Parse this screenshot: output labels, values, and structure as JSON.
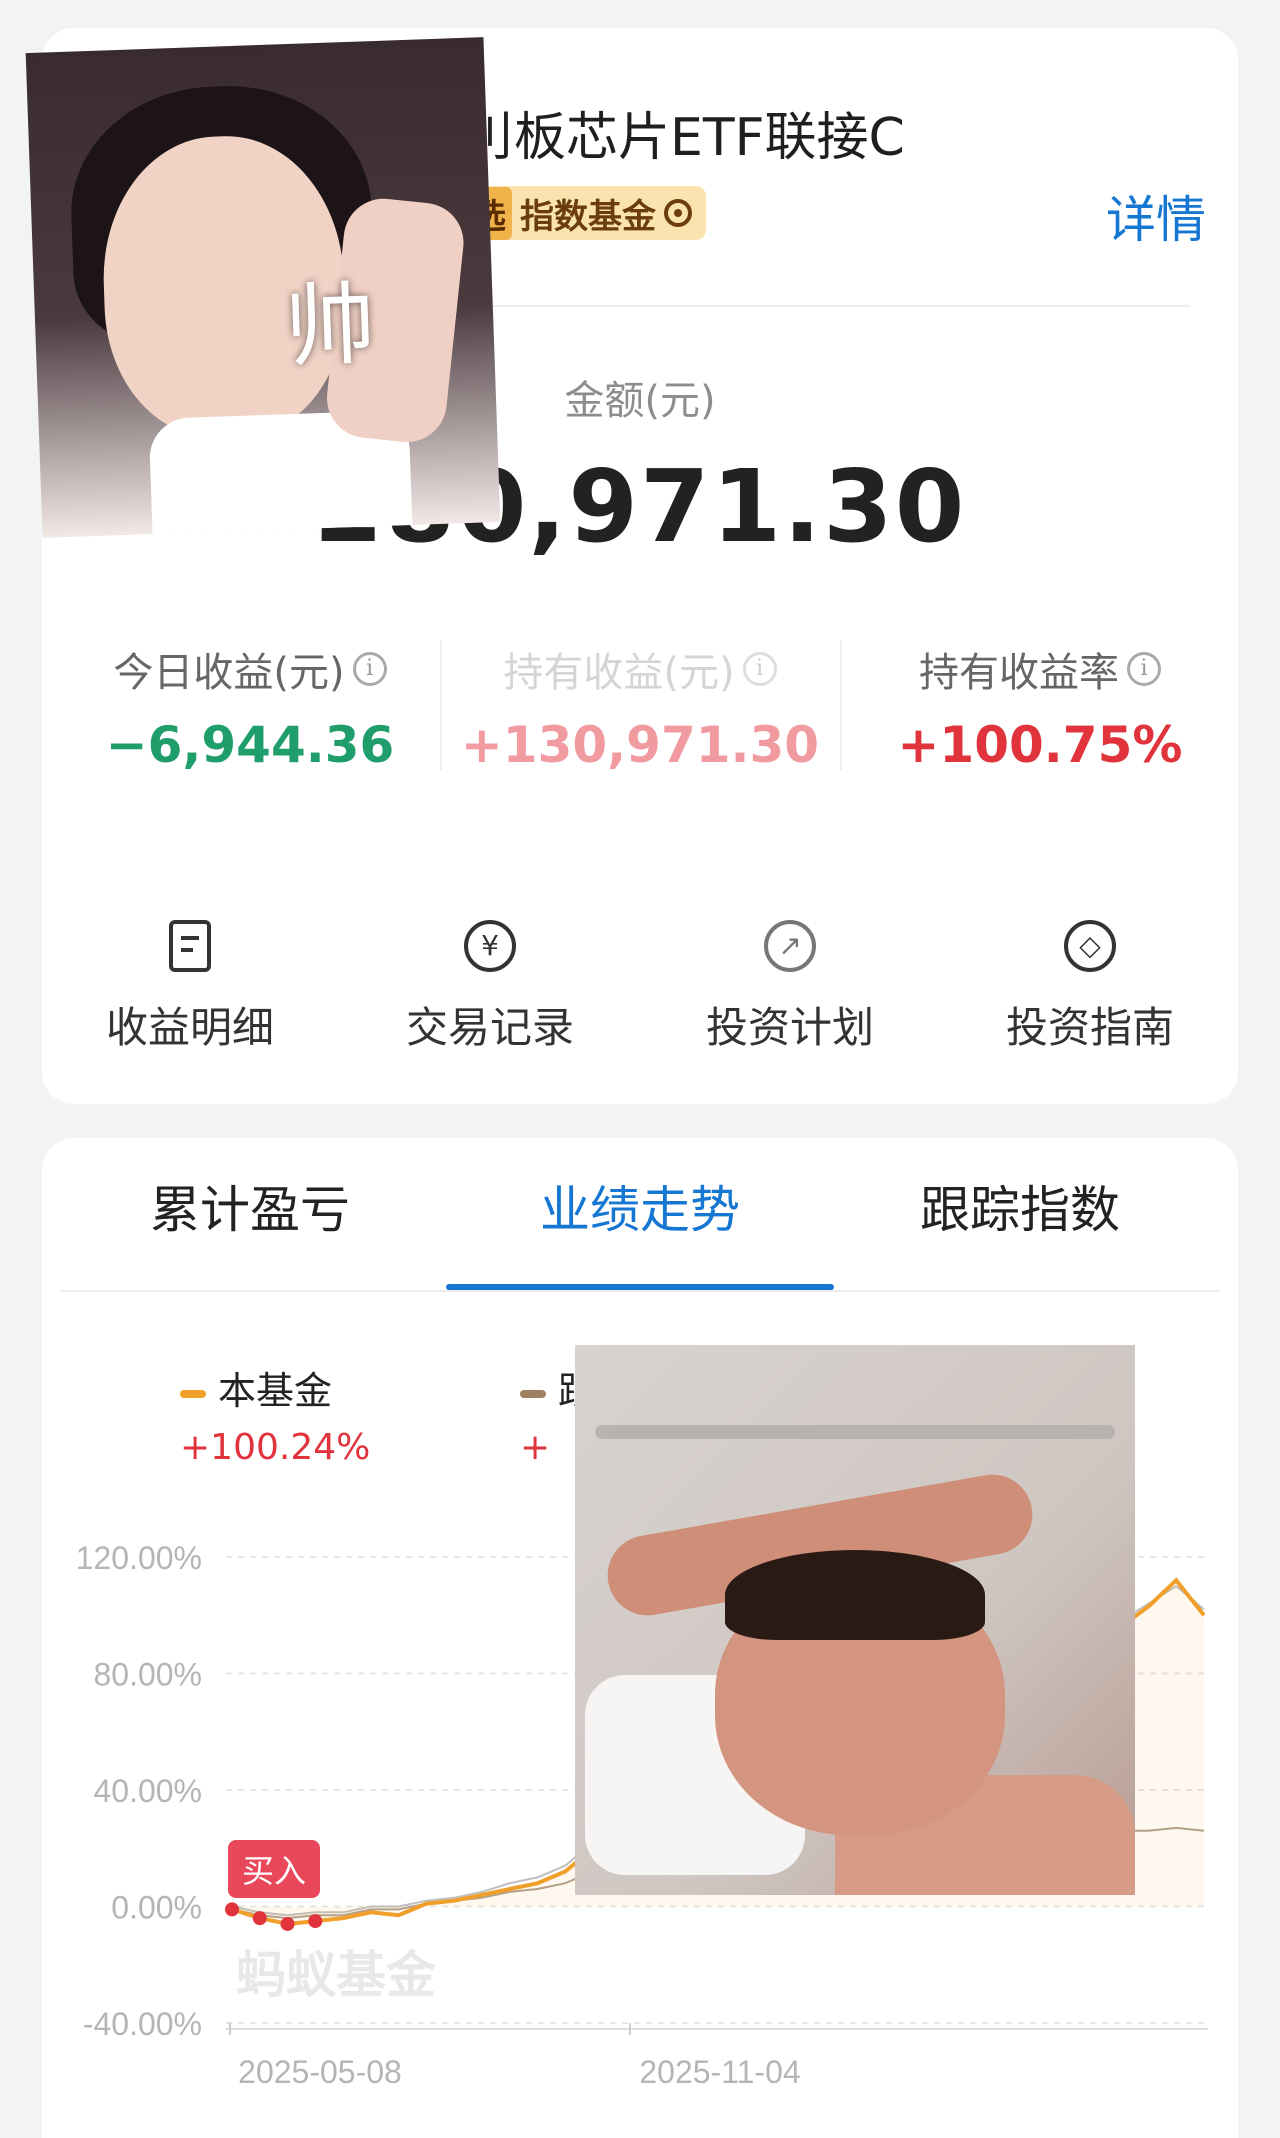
{
  "fund": {
    "name": "…刂板芯片ETF联接C",
    "tag_badge": "选",
    "tag_label": "指数基金",
    "detail_link": "详情",
    "target_icon": "target-icon"
  },
  "amount": {
    "label": "金额(元)",
    "value": "280,971.30"
  },
  "stats": [
    {
      "label": "今日收益(元)",
      "value": "−6,944.36",
      "color": "#1f9d6b"
    },
    {
      "label": "持有收益(元)",
      "value": "+130,971.30",
      "color": "#f19aa0"
    },
    {
      "label": "持有收益率",
      "value": "+100.75%",
      "color": "#e0333b"
    }
  ],
  "actions": [
    {
      "label": "收益明细",
      "icon": "document-icon"
    },
    {
      "label": "交易记录",
      "icon": "yen-icon"
    },
    {
      "label": "投资计划",
      "icon": "trend-icon"
    },
    {
      "label": "投资指南",
      "icon": "compass-icon"
    }
  ],
  "tabs": [
    "累计盈亏",
    "业绩走势",
    "跟踪指数"
  ],
  "active_tab": "业绩走势",
  "legend": [
    {
      "name": "本基金",
      "pct": "+100.24%",
      "color": "#f0a02a"
    },
    {
      "name": "跟",
      "pct": "+",
      "color": "#a08060"
    }
  ],
  "buy_marker": "买入",
  "watermark": "蚂蚁基金",
  "overlay_text": "帅",
  "chart_data": {
    "type": "line",
    "x_start": "2025-03-01",
    "x_ticks": [
      "2025-05-08",
      "2025-11-04"
    ],
    "y_ticks": [
      "120.00%",
      "80.00%",
      "40.00%",
      "0.00%",
      "-40.00%"
    ],
    "ylim": [
      -40,
      120
    ],
    "series": [
      {
        "name": "本基金",
        "color": "#f0a02a",
        "values": [
          -1,
          -4,
          -6,
          -5,
          -4,
          -2,
          -3,
          1,
          2,
          4,
          6,
          8,
          12,
          20,
          30,
          42,
          28,
          22,
          28,
          32,
          36,
          45,
          48,
          52,
          56,
          62,
          68,
          74,
          78,
          82,
          86,
          90,
          96,
          103,
          112,
          100
        ]
      },
      {
        "name": "跟",
        "color": "#b0a090",
        "values": [
          -1,
          -3,
          -4,
          -3,
          -3,
          -1,
          -1,
          1,
          2,
          3,
          5,
          6,
          8,
          12,
          16,
          20,
          16,
          14,
          16,
          17,
          18,
          19,
          20,
          21,
          22,
          22,
          23,
          23,
          24,
          24,
          25,
          25,
          26,
          26,
          27,
          26
        ]
      },
      {
        "name": "",
        "color": "#bfbfbf",
        "values": [
          0,
          -2,
          -3,
          -2,
          -2,
          0,
          0,
          2,
          3,
          5,
          8,
          10,
          14,
          22,
          32,
          40,
          32,
          28,
          34,
          38,
          42,
          50,
          54,
          58,
          62,
          66,
          70,
          75,
          80,
          84,
          88,
          92,
          98,
          104,
          110,
          102
        ]
      }
    ],
    "buy_points": [
      0,
      1,
      2,
      3
    ]
  },
  "colors": {
    "accent": "#1677d2",
    "positive": "#e0333b",
    "negative": "#1f9d6b"
  }
}
